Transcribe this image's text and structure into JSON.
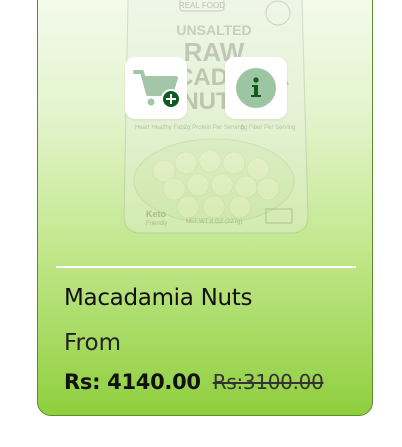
{
  "product": {
    "name": "Macadamia Nuts",
    "from_label": "From",
    "price": "Rs: 4140.00",
    "old_price": "Rs:3100.00"
  },
  "package_text": {
    "brand": "REAL FOOD",
    "line1": "UNSALTED",
    "line2": "RAW",
    "line3": "MACADAMIA",
    "line4": "NUTS",
    "badge1": "Keto",
    "badge1_sub": "Friendly",
    "net_wt": "NET WT 8 OZ (227g)",
    "claim1": "Heart Healthy Fats",
    "claim2": "2g Protein Per Serving",
    "claim3": "3g Fiber Per Serving"
  },
  "buttons": {
    "add_to_cart_icon": "cart-plus-icon",
    "info_icon": "info-icon"
  },
  "colors": {
    "card_gradient_top": "#f6fbef",
    "card_gradient_bottom": "#8fcf3e",
    "card_border": "#5b8f2c",
    "cart_icon": "#a3c6a9",
    "plus_badge": "#0f5a1e",
    "info_circle": "#9cc6a2",
    "info_glyph": "#0f5a1e"
  }
}
